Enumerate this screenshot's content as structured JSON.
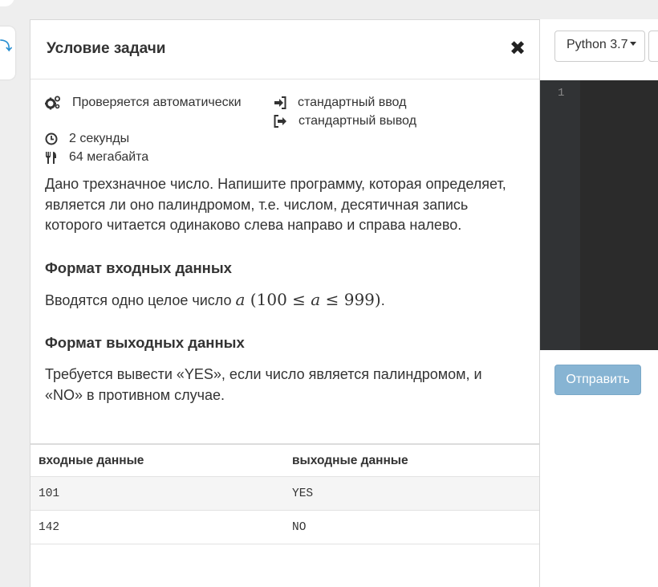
{
  "problem": {
    "title": "Условие задачи",
    "close_symbol": "✖",
    "meta": {
      "check": "Проверяется автоматически",
      "input": "стандартный ввод",
      "output": "стандартный вывод",
      "time": "2 секунды",
      "memory": "64 мегабайта"
    },
    "description": "Дано трехзначное число. Напишите программу, которая определяет, является ли оно палиндромом, т.е. числом, десятичная запись которого читается одинаково слева направо и справа налево.",
    "input_format": {
      "heading": "Формат входных данных",
      "text_before": "Вводятся одно целое число",
      "var": "a",
      "lower": "100",
      "upper": "999",
      "text_after": "."
    },
    "output_format": {
      "heading": "Формат выходных данных",
      "text": "Требуется вывести «YES», если число является палиндромом, и «NO» в противном случае."
    },
    "samples": {
      "headers": [
        "входные данные",
        "выходные данные"
      ],
      "rows": [
        {
          "input": "101",
          "output": "YES"
        },
        {
          "input": "142",
          "output": "NO"
        }
      ]
    }
  },
  "editor": {
    "language": "Python 3.7",
    "line_number": "1",
    "submit_label": "Отправить"
  },
  "icons": {
    "check": "cogs-icon",
    "input": "sign-in-icon",
    "output": "sign-out-icon",
    "time": "clock-icon",
    "memory": "cutlery-icon",
    "close": "close-icon"
  },
  "colors": {
    "submit": "#87b4d3",
    "editor_bg": "#2b2b2b",
    "gutter_bg": "#313335",
    "sample_stripe": "#f5f5f5",
    "side_accent": "#2a8fd1"
  }
}
